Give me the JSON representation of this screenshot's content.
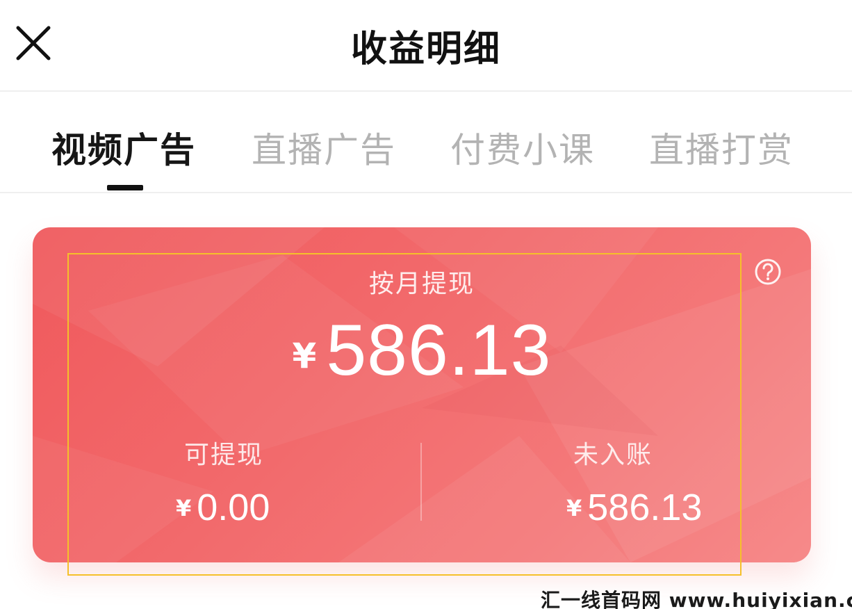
{
  "header": {
    "title": "收益明细",
    "close_icon": "close-icon"
  },
  "tabs": [
    {
      "label": "视频广告",
      "active": true
    },
    {
      "label": "直播广告",
      "active": false
    },
    {
      "label": "付费小课",
      "active": false
    },
    {
      "label": "直播打赏",
      "active": false
    }
  ],
  "card": {
    "title": "按月提现",
    "help_icon": "question-circle-icon",
    "total": {
      "currency": "¥",
      "amount": "586.13"
    },
    "withdrawable": {
      "label": "可提现",
      "currency": "¥",
      "amount": "0.00"
    },
    "pending": {
      "label": "未入账",
      "currency": "¥",
      "amount": "586.13"
    },
    "colors": {
      "gradient_start": "#f0595c",
      "gradient_end": "#f68a8a",
      "highlight": "#f5c02a"
    }
  },
  "watermark": "汇一线首码网 www.huiyixian.com"
}
